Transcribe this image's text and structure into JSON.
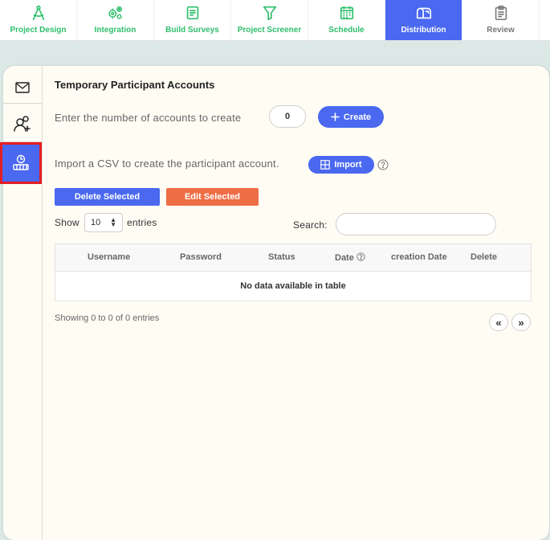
{
  "nav": [
    {
      "label": "Project Design",
      "icon": "compass-icon"
    },
    {
      "label": "Integration",
      "icon": "gears-icon"
    },
    {
      "label": "Build Surveys",
      "icon": "document-icon"
    },
    {
      "label": "Project Screener",
      "icon": "funnel-icon"
    },
    {
      "label": "Schedule",
      "icon": "calendar-icon"
    },
    {
      "label": "Distribution",
      "icon": "mailbox-icon",
      "active": true
    },
    {
      "label": "Review",
      "icon": "clipboard-icon"
    }
  ],
  "sidebar": [
    "envelope-icon",
    "add-user-icon",
    "distribution-icon"
  ],
  "page": {
    "title": "Temporary Participant Accounts",
    "accounts_label": "Enter the number of accounts to create",
    "accounts_value": "0",
    "create_label": "Create",
    "import_text": "Import a CSV to create the participant account.",
    "import_label": "Import",
    "delete_label": "Delete Selected",
    "edit_label": "Edit Selected"
  },
  "table": {
    "show_label": "Show",
    "entries_label": "entries",
    "page_size": "10",
    "search_label": "Search:",
    "columns": [
      "Username",
      "Password",
      "Status",
      "Date",
      "creation Date",
      "Delete"
    ],
    "empty_text": "No data available in table",
    "info": "Showing 0 to 0 of 0 entries",
    "prev": "«",
    "next": "»"
  },
  "colors": {
    "accent": "#4a68f0",
    "green": "#2ebf6b",
    "orange": "#ef6d45",
    "highlight": "#e41e25"
  }
}
